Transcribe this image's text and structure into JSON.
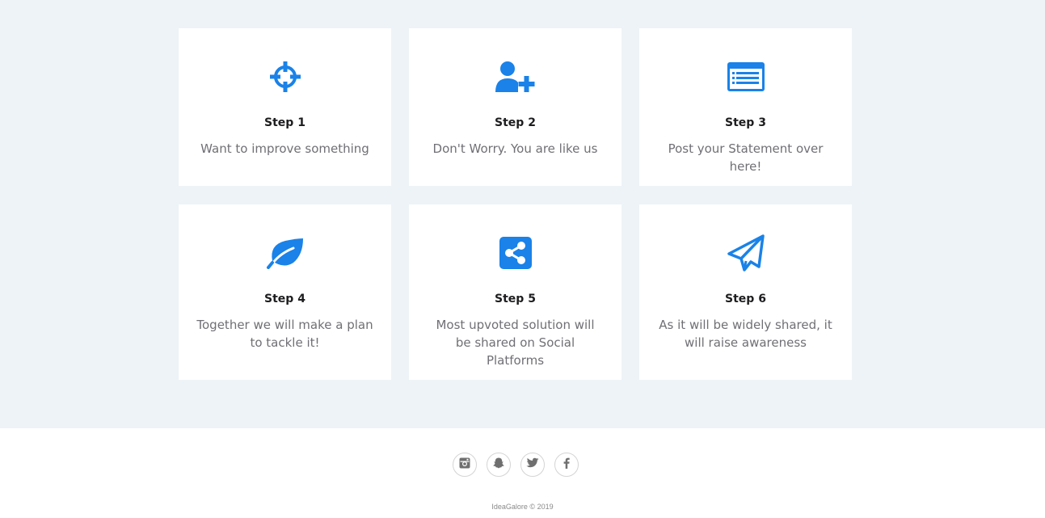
{
  "colors": {
    "accent": "#1a82e8",
    "section_bg": "#eef3f7",
    "card_bg": "#ffffff",
    "title": "#1d1d1f",
    "text": "#707075",
    "social_icon": "#6f6f6f"
  },
  "steps": [
    {
      "icon": "crosshair-icon",
      "title": "Step 1",
      "description": "Want to improve something"
    },
    {
      "icon": "user-plus-icon",
      "title": "Step 2",
      "description": "Don't Worry. You are like us"
    },
    {
      "icon": "list-window-icon",
      "title": "Step 3",
      "description": "Post your Statement over here!"
    },
    {
      "icon": "leaf-icon",
      "title": "Step 4",
      "description": "Together we will make a plan to tackle it!"
    },
    {
      "icon": "share-square-icon",
      "title": "Step 5",
      "description": "Most upvoted solution will be shared on Social Platforms"
    },
    {
      "icon": "paper-plane-icon",
      "title": "Step 6",
      "description": "As it will be widely shared, it will raise awareness"
    }
  ],
  "footer": {
    "social": [
      {
        "icon": "instagram-icon"
      },
      {
        "icon": "snapchat-icon"
      },
      {
        "icon": "twitter-icon"
      },
      {
        "icon": "facebook-icon"
      }
    ],
    "copyright": "IdeaGalore © 2019"
  }
}
